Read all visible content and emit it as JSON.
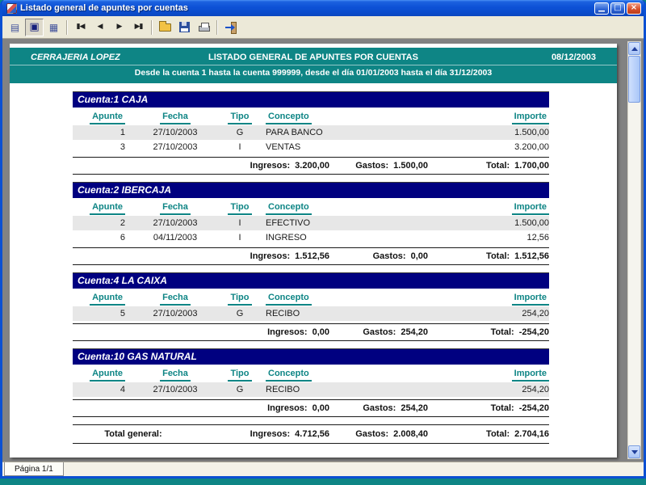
{
  "colors": {
    "titlebar_blue": "#0B50D2",
    "report_header_teal": "#0E8585",
    "section_bar_navy": "#000080",
    "column_header_teal": "#0E8585",
    "desktop_teal": "#0E8585"
  },
  "window": {
    "title": "Listado general de apuntes por cuentas",
    "controls": {
      "minimize": "▁",
      "maximize": "□",
      "close": "×"
    }
  },
  "toolbar": {
    "view_buttons": [
      {
        "name": "list-view",
        "glyph": "▤"
      },
      {
        "name": "page-view",
        "glyph": "▣"
      },
      {
        "name": "multipage-view",
        "glyph": "▦"
      }
    ],
    "nav_buttons": [
      {
        "name": "first-page",
        "glyph": "▮◀"
      },
      {
        "name": "prev-page",
        "glyph": "◀"
      },
      {
        "name": "next-page",
        "glyph": "▶"
      },
      {
        "name": "last-page",
        "glyph": "▶▮"
      }
    ],
    "file_icons": [
      "open-folder-icon",
      "save-icon",
      "print-icon",
      "exit-icon"
    ]
  },
  "report": {
    "company": "CERRAJERIA LOPEZ",
    "title": "LISTADO GENERAL DE APUNTES POR CUENTAS",
    "date": "08/12/2003",
    "subtitle": "Desde la cuenta 1 hasta la cuenta 999999, desde el día 01/01/2003 hasta el día 31/12/2003",
    "columns": [
      "Apunte",
      "Fecha",
      "Tipo",
      "Concepto",
      "Importe"
    ],
    "labels": {
      "ingresos": "Ingresos:",
      "gastos": "Gastos:",
      "total": "Total:",
      "total_general": "Total general:"
    },
    "accounts": [
      {
        "header": "Cuenta:1 CAJA",
        "rows": [
          {
            "apunte": "1",
            "fecha": "27/10/2003",
            "tipo": "G",
            "concepto": "PARA BANCO",
            "importe": "1.500,00"
          },
          {
            "apunte": "3",
            "fecha": "27/10/2003",
            "tipo": "I",
            "concepto": "VENTAS",
            "importe": "3.200,00"
          }
        ],
        "summary": {
          "ingresos": "3.200,00",
          "gastos": "1.500,00",
          "total": "1.700,00"
        }
      },
      {
        "header": "Cuenta:2 IBERCAJA",
        "rows": [
          {
            "apunte": "2",
            "fecha": "27/10/2003",
            "tipo": "I",
            "concepto": "EFECTIVO",
            "importe": "1.500,00"
          },
          {
            "apunte": "6",
            "fecha": "04/11/2003",
            "tipo": "I",
            "concepto": "INGRESO",
            "importe": "12,56"
          }
        ],
        "summary": {
          "ingresos": "1.512,56",
          "gastos": "0,00",
          "total": "1.512,56"
        }
      },
      {
        "header": "Cuenta:4 LA CAIXA",
        "rows": [
          {
            "apunte": "5",
            "fecha": "27/10/2003",
            "tipo": "G",
            "concepto": "RECIBO",
            "importe": "254,20"
          }
        ],
        "summary": {
          "ingresos": "0,00",
          "gastos": "254,20",
          "total": "-254,20"
        }
      },
      {
        "header": "Cuenta:10 GAS NATURAL",
        "rows": [
          {
            "apunte": "4",
            "fecha": "27/10/2003",
            "tipo": "G",
            "concepto": "RECIBO",
            "importe": "254,20"
          }
        ],
        "summary": {
          "ingresos": "0,00",
          "gastos": "254,20",
          "total": "-254,20"
        }
      }
    ],
    "grand_total": {
      "ingresos": "4.712,56",
      "gastos": "2.008,40",
      "total": "2.704,16"
    }
  },
  "statusbar": {
    "page_label": "Página 1/1"
  }
}
